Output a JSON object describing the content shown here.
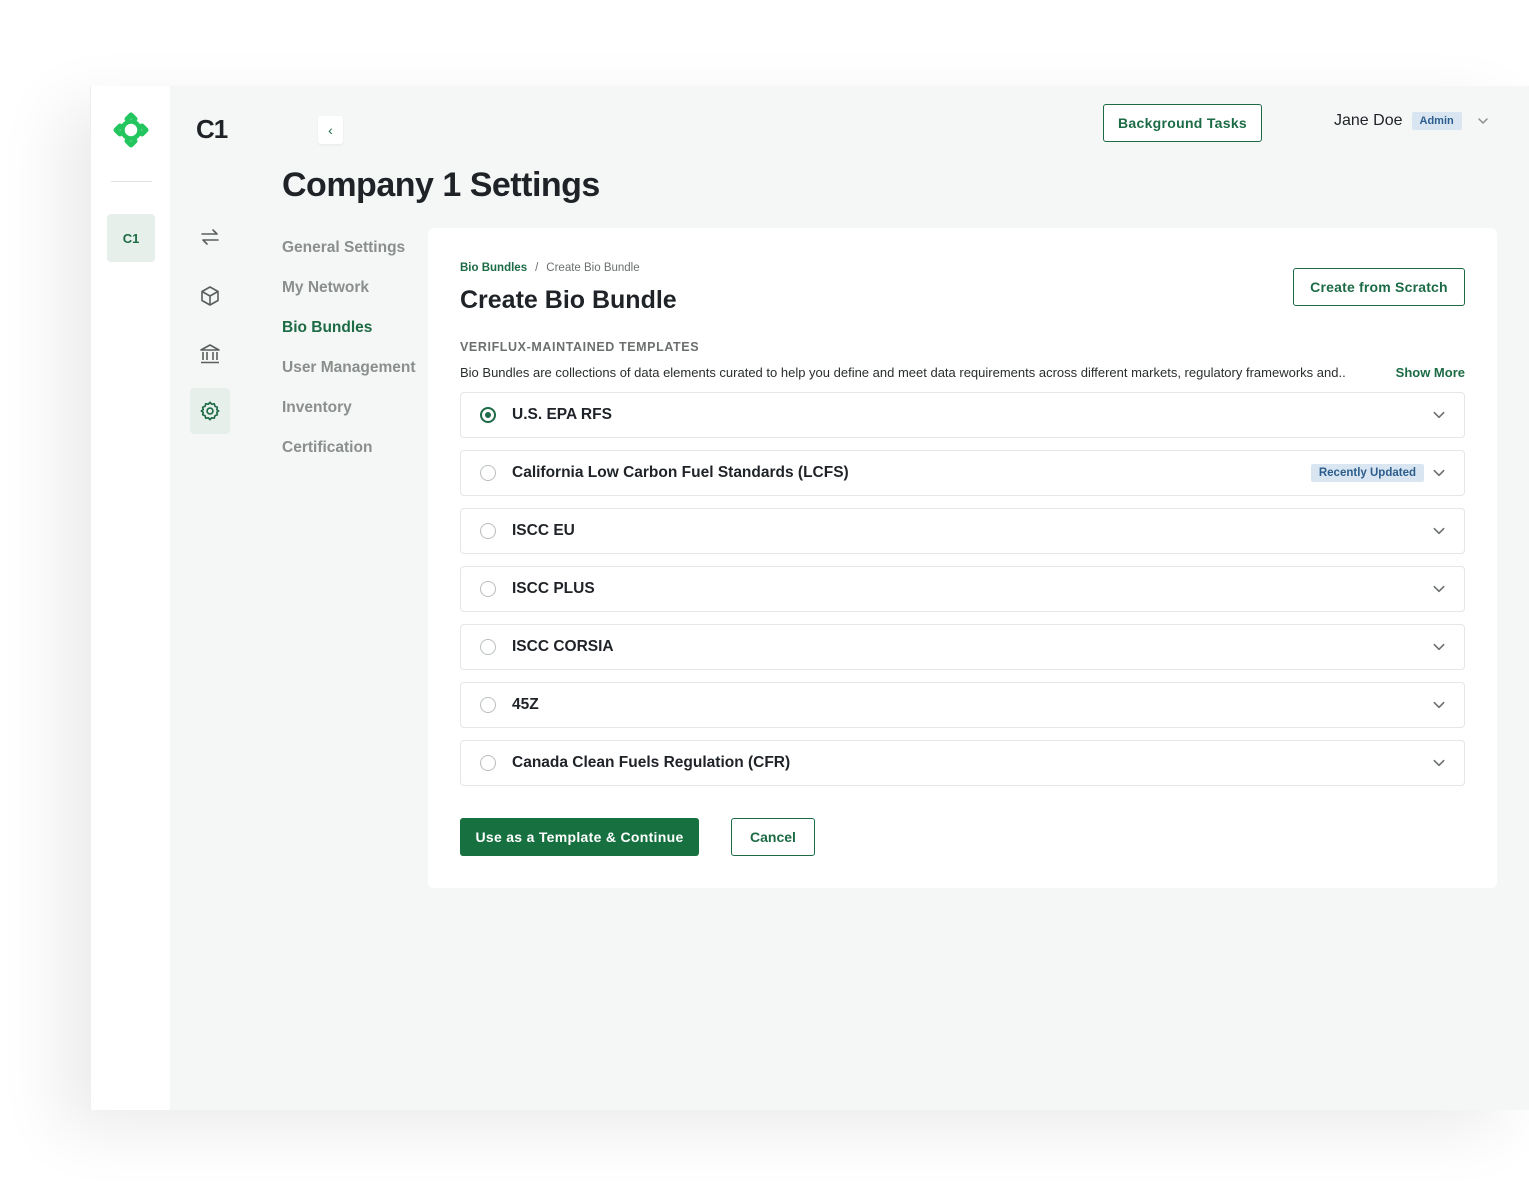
{
  "app": {
    "brand": "C1",
    "company_chip": "C1",
    "page_title": "Company 1 Settings"
  },
  "header": {
    "background_tasks": "Background Tasks",
    "user_name": "Jane Doe",
    "user_role": "Admin"
  },
  "settings_nav": [
    {
      "label": "General Settings",
      "active": false
    },
    {
      "label": "My Network",
      "active": false
    },
    {
      "label": "Bio Bundles",
      "active": true
    },
    {
      "label": "User Management",
      "active": false
    },
    {
      "label": "Inventory",
      "active": false
    },
    {
      "label": "Certification",
      "active": false
    }
  ],
  "card": {
    "breadcrumb": {
      "parent": "Bio Bundles",
      "separator": "/",
      "current": "Create Bio Bundle"
    },
    "title": "Create Bio Bundle",
    "create_from_scratch": "Create from Scratch",
    "section_label": "VERIFLUX-MAINTAINED TEMPLATES",
    "description": "Bio Bundles are collections of data elements curated to help you define and meet data requirements across different markets, regulatory frameworks and..",
    "show_more": "Show More",
    "templates": [
      {
        "name": "U.S. EPA RFS",
        "selected": true,
        "badge": ""
      },
      {
        "name": "California Low Carbon Fuel Standards (LCFS)",
        "selected": false,
        "badge": "Recently Updated"
      },
      {
        "name": "ISCC EU",
        "selected": false,
        "badge": ""
      },
      {
        "name": "ISCC PLUS",
        "selected": false,
        "badge": ""
      },
      {
        "name": "ISCC CORSIA",
        "selected": false,
        "badge": ""
      },
      {
        "name": "45Z",
        "selected": false,
        "badge": ""
      },
      {
        "name": "Canada Clean Fuels Regulation (CFR)",
        "selected": false,
        "badge": ""
      }
    ],
    "primary_button": "Use as a Template & Continue",
    "cancel_button": "Cancel"
  },
  "colors": {
    "accent": "#1c6b45",
    "primary_button": "#17703f",
    "logo": "#22c55e",
    "badge_bg": "#d9e6f2",
    "badge_text": "#2c5d8c"
  }
}
